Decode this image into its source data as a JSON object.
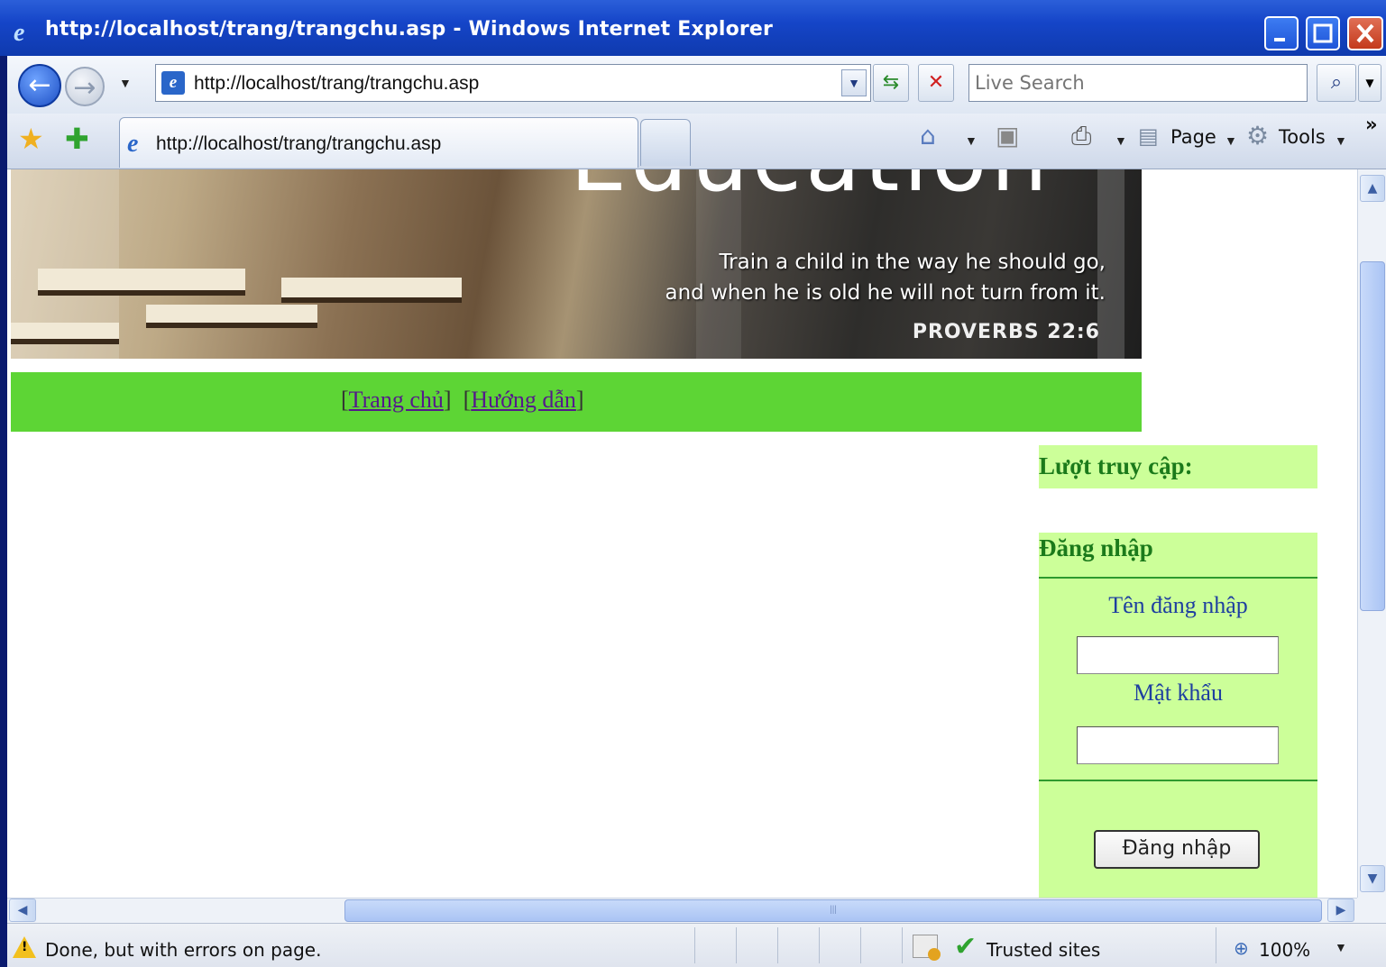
{
  "window": {
    "title": "http://localhost/trang/trangchu.asp - Windows Internet Explorer"
  },
  "address_bar": {
    "url": "http://localhost/trang/trangchu.asp",
    "search_placeholder": "Live Search"
  },
  "tab": {
    "label": "http://localhost/trang/trangchu.asp"
  },
  "command_bar": {
    "page_label": "Page",
    "tools_label": "Tools"
  },
  "banner": {
    "heading": "Education",
    "quote_line1": "Train a child in the way he should go,",
    "quote_line2": "and when he is old he will not turn from it.",
    "reference": "PROVERBS 22:6"
  },
  "nav": {
    "home_label": "Trang chủ",
    "guide_label": "Hướng dẫn"
  },
  "sidebar": {
    "visits_heading": "Lượt truy cập:",
    "login_heading": "Đăng nhập",
    "username_label": "Tên đăng nhập",
    "password_label": "Mật khẩu",
    "login_button": "Đăng nhập"
  },
  "status_bar": {
    "message": "Done, but with errors on page.",
    "zone": "Trusted sites",
    "zoom": "100%"
  },
  "colors": {
    "nav_bar": "#5dd535",
    "sidebar_box": "#ccff99",
    "sidebar_heading": "#1b7a1b",
    "sidebar_label": "#1e3fa0"
  }
}
